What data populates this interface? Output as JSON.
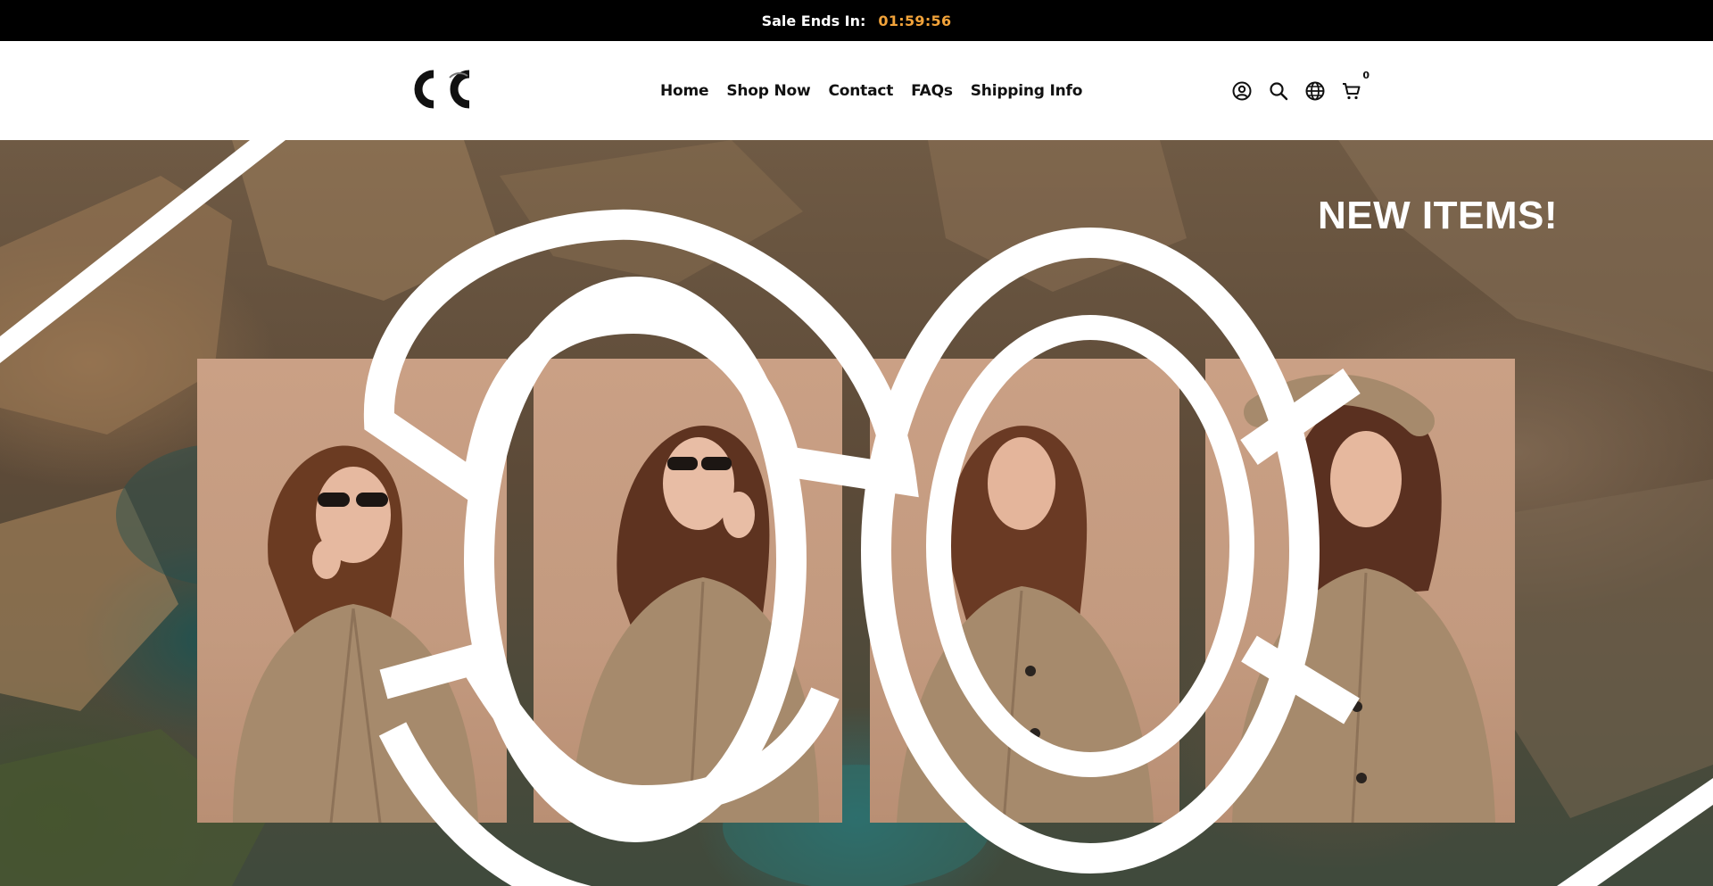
{
  "announcement": {
    "label": "Sale Ends In:",
    "timer": "01:59:56",
    "timer_color": "#f2a33a"
  },
  "header": {
    "logo_icon": "cc-logo-icon",
    "nav": [
      {
        "label": "Home"
      },
      {
        "label": "Shop Now"
      },
      {
        "label": "Contact"
      },
      {
        "label": "FAQs"
      },
      {
        "label": "Shipping Info"
      }
    ],
    "icons": [
      {
        "name": "account-icon"
      },
      {
        "name": "search-icon"
      },
      {
        "name": "globe-icon"
      },
      {
        "name": "cart-icon"
      }
    ],
    "cart_count": "0"
  },
  "hero": {
    "title": "NEW ITEMS!",
    "overlay_mark": "cc-monogram-icon",
    "panels": [
      {
        "name": "model-photo-1"
      },
      {
        "name": "model-photo-2"
      },
      {
        "name": "model-photo-3"
      },
      {
        "name": "model-photo-4"
      }
    ]
  },
  "colors": {
    "bar_background": "#000000",
    "coat": "#a68a6c",
    "panel_background": "#c69d82"
  }
}
